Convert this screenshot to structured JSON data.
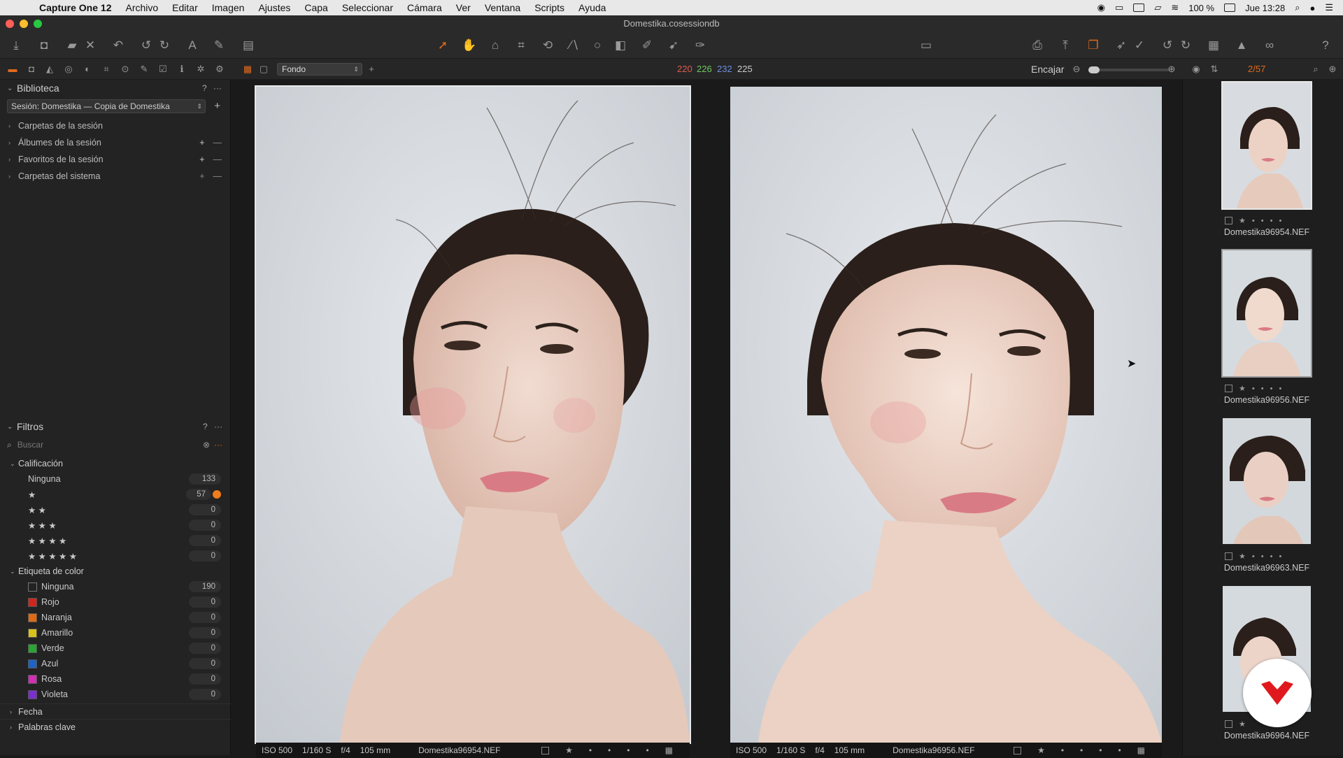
{
  "menubar": {
    "app_name": "Capture One 12",
    "items": [
      "Archivo",
      "Editar",
      "Imagen",
      "Ajustes",
      "Capa",
      "Seleccionar",
      "Cámara",
      "Ver",
      "Ventana",
      "Scripts",
      "Ayuda"
    ],
    "battery": "100 %",
    "clock": "Jue 13:28"
  },
  "window": {
    "title": "Domestika.cosessiondb"
  },
  "subbar": {
    "variant": "Fondo",
    "rgb": {
      "r": "220",
      "g": "226",
      "b": "232",
      "l": "225"
    },
    "fit_label": "Encajar",
    "counter": "2/57"
  },
  "library": {
    "title": "Biblioteca",
    "help": "?",
    "session": "Sesión: Domestika — Copia de Domestika",
    "tree": [
      {
        "label": "Carpetas de la sesión"
      },
      {
        "label": "Álbumes de la sesión"
      },
      {
        "label": "Favoritos de la sesión"
      },
      {
        "label": "Carpetas del sistema"
      }
    ]
  },
  "filters": {
    "title": "Filtros",
    "help": "?",
    "search_placeholder": "Buscar",
    "rating_header": "Calificación",
    "ratings": [
      {
        "label": "Ninguna",
        "count": "133"
      },
      {
        "label": "★",
        "count": "57"
      },
      {
        "label": "★ ★",
        "count": "0"
      },
      {
        "label": "★ ★ ★",
        "count": "0"
      },
      {
        "label": "★ ★ ★ ★",
        "count": "0"
      },
      {
        "label": "★ ★ ★ ★ ★",
        "count": "0"
      }
    ],
    "color_header": "Etiqueta de color",
    "colors": [
      {
        "label": "Ninguna",
        "count": "190",
        "color": "transparent"
      },
      {
        "label": "Rojo",
        "count": "0",
        "color": "#d0261e"
      },
      {
        "label": "Naranja",
        "count": "0",
        "color": "#e06b12"
      },
      {
        "label": "Amarillo",
        "count": "0",
        "color": "#d8c21a"
      },
      {
        "label": "Verde",
        "count": "0",
        "color": "#2aa432"
      },
      {
        "label": "Azul",
        "count": "0",
        "color": "#1f62c8"
      },
      {
        "label": "Rosa",
        "count": "0",
        "color": "#d12fb4"
      },
      {
        "label": "Violeta",
        "count": "0",
        "color": "#7b2fd0"
      }
    ],
    "extra": [
      "Fecha",
      "Palabras clave"
    ]
  },
  "viewer": {
    "left": {
      "iso": "ISO 500",
      "shutter": "1/160 S",
      "aperture": "f/4",
      "focal": "105 mm",
      "filename": "Domestika96954.NEF"
    },
    "right": {
      "iso": "ISO 500",
      "shutter": "1/160 S",
      "aperture": "f/4",
      "focal": "105 mm",
      "filename": "Domestika96956.NEF"
    }
  },
  "browser": {
    "thumbs": [
      {
        "name": "Domestika96954.NEF"
      },
      {
        "name": "Domestika96956.NEF"
      },
      {
        "name": "Domestika96963.NEF"
      },
      {
        "name": "Domestika96964.NEF"
      }
    ]
  },
  "colors": {
    "accent": "#e36a1b",
    "badge_red": "#e0191e"
  }
}
